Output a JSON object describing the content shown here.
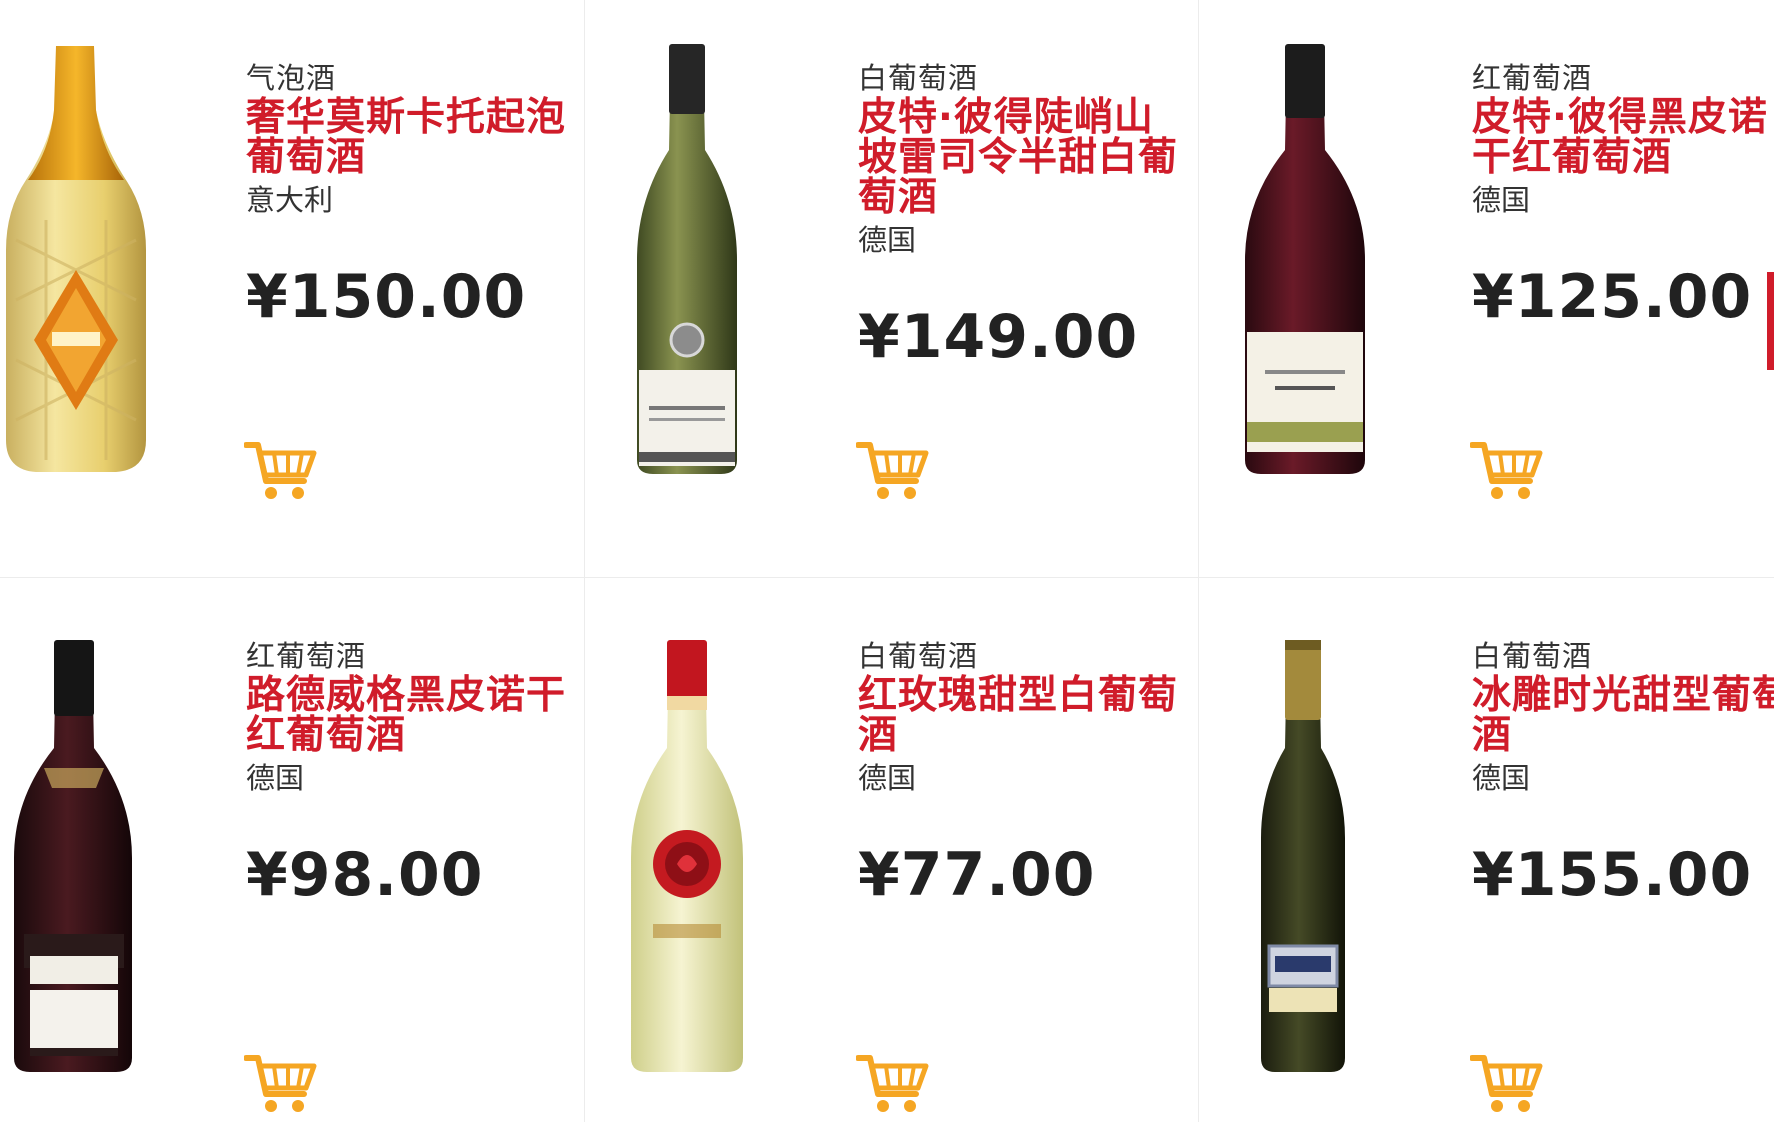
{
  "accent_color": "#d01c2a",
  "cart_color": "#f5a623",
  "products": [
    {
      "category": "气泡酒",
      "name": "奢华莫斯卡托起泡葡萄酒",
      "origin": "意大利",
      "price": "¥150.00",
      "bottle_icon": "sparkling-wine-bottle-icon"
    },
    {
      "category": "白葡萄酒",
      "name": "皮特·彼得陡峭山坡雷司令半甜白葡萄酒",
      "origin": "德国",
      "price": "¥149.00",
      "bottle_icon": "white-wine-bottle-icon"
    },
    {
      "category": "红葡萄酒",
      "name": "皮特·彼得黑皮诺干红葡萄酒",
      "origin": "德国",
      "price": "¥125.00",
      "bottle_icon": "red-wine-bottle-icon"
    },
    {
      "category": "红葡萄酒",
      "name": "路德威格黑皮诺干红葡萄酒",
      "origin": "德国",
      "price": "¥98.00",
      "bottle_icon": "red-wine-bottle-icon"
    },
    {
      "category": "白葡萄酒",
      "name": "红玫瑰甜型白葡萄酒",
      "origin": "德国",
      "price": "¥77.00",
      "bottle_icon": "white-wine-bottle-icon"
    },
    {
      "category": "白葡萄酒",
      "name": "冰雕时光甜型葡萄酒",
      "origin": "德国",
      "price": "¥155.00",
      "bottle_icon": "dessert-wine-bottle-icon"
    }
  ]
}
